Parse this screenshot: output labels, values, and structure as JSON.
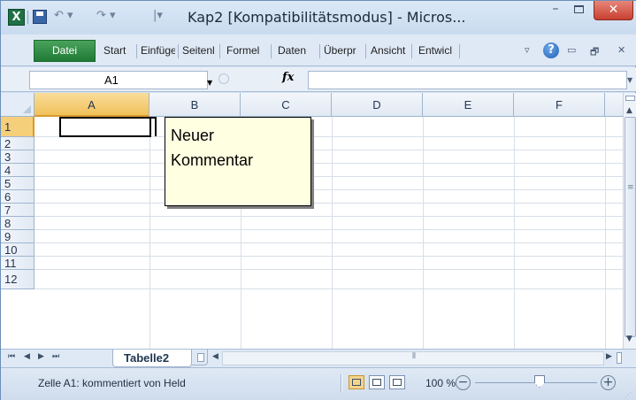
{
  "window": {
    "title": "Kap2  [Kompatibilitätsmodus]  -  Micros...",
    "minimize_glyph": "–",
    "close_glyph": "✕"
  },
  "quick_access": {
    "logo": "X",
    "undo_glyph": "↶ ▾",
    "redo_glyph": "↷ ▾",
    "customize_glyph": "|▾"
  },
  "ribbon": {
    "file_tab": "Datei",
    "tabs": [
      "Start",
      "Einfüge",
      "Seitenl",
      "Formel",
      "Daten",
      "Überpr",
      "Ansicht",
      "Entwicl"
    ],
    "expand_glyph": "▿",
    "help_glyph": "?",
    "minimize_ribbon_glyph": "▭",
    "restore_glyph": "🗗",
    "close_doc_glyph": "✕"
  },
  "formula_bar": {
    "name_box": "A1",
    "fx": "fx",
    "formula": ""
  },
  "grid": {
    "columns": [
      "A",
      "B",
      "C",
      "D",
      "E",
      "F"
    ],
    "rows": [
      "1",
      "2",
      "3",
      "4",
      "5",
      "6",
      "7",
      "8",
      "9",
      "10",
      "11",
      "12"
    ],
    "active_cell": "A1"
  },
  "comment": {
    "text": "Neuer\nKommentar"
  },
  "sheets": {
    "active": "Tabelle2",
    "nav": [
      "⏮",
      "◀",
      "▶",
      "⏭"
    ]
  },
  "statusbar": {
    "text": "Zelle A1: kommentiert von Held",
    "zoom": "100 %",
    "zoom_minus": "−",
    "zoom_plus": "+"
  }
}
